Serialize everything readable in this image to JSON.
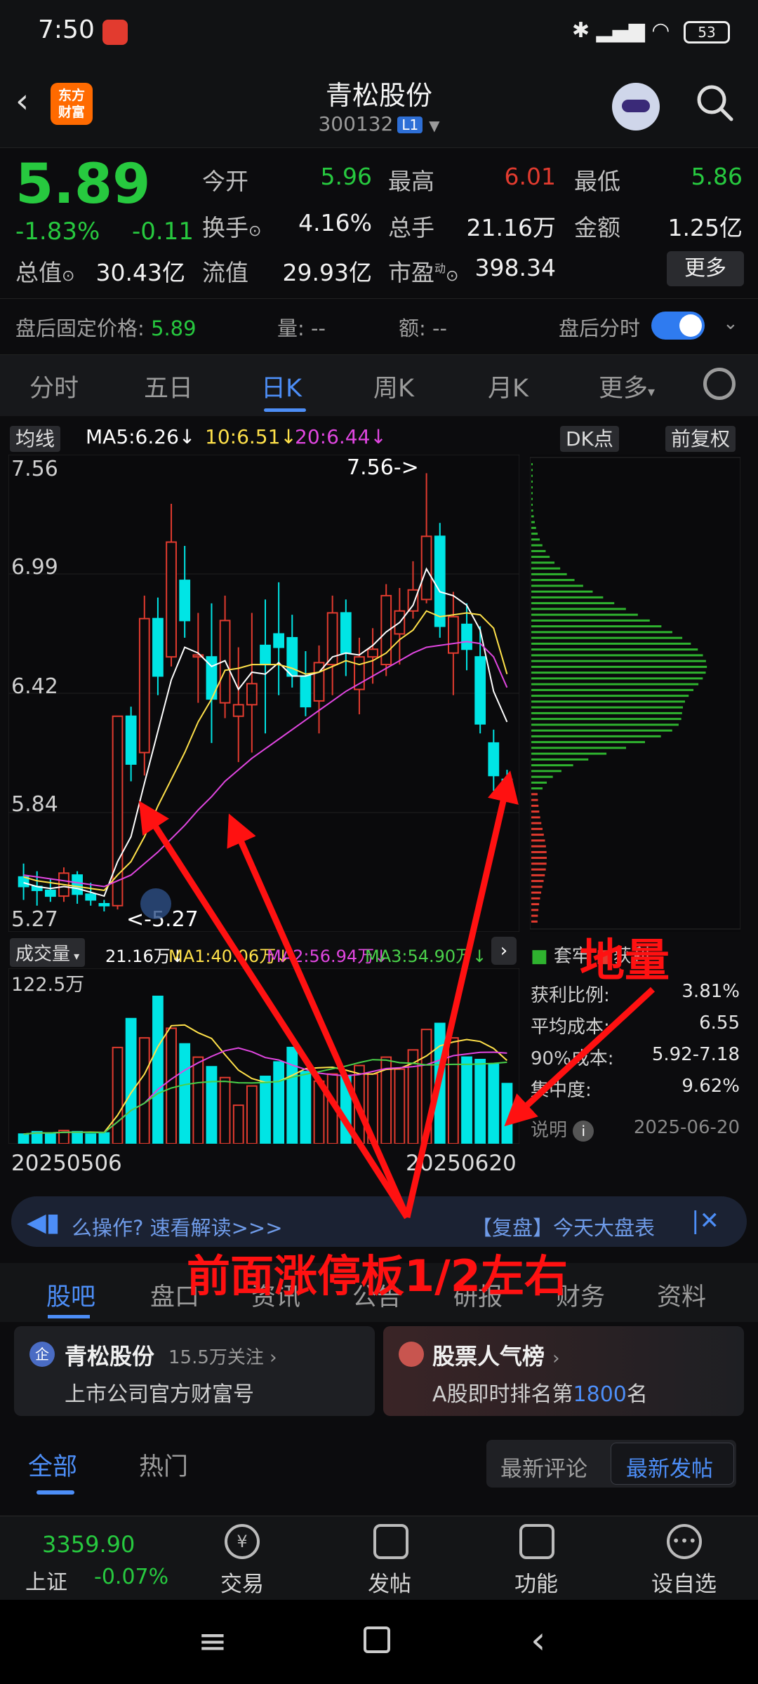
{
  "status_bar": {
    "time": "7:50",
    "battery": "53"
  },
  "header": {
    "title": "青松股份",
    "code": "300132",
    "level": "L1",
    "logo_text_1": "东方",
    "logo_text_2": "财富"
  },
  "quote": {
    "price": "5.89",
    "change_pct": "-1.83%",
    "change": "-0.11",
    "open_label": "今开",
    "open": "5.96",
    "high_label": "最高",
    "high": "6.01",
    "low_label": "最低",
    "low": "5.86",
    "turnover_label": "换手",
    "turnover": "4.16%",
    "volume_label": "总手",
    "volume": "21.16万",
    "amount_label": "金额",
    "amount": "1.25亿",
    "mcap_label": "总值",
    "mcap": "30.43亿",
    "float_label": "流值",
    "float": "29.93亿",
    "pe_label": "市盈",
    "pe_sup": "动",
    "pe": "398.34",
    "more": "更多"
  },
  "after_hours": {
    "price_label": "盘后固定价格:",
    "price": "5.89",
    "vol": "量: --",
    "amt": "额: --",
    "toggle_label": "盘后分时",
    "toggle_on": true
  },
  "tabs": [
    "分时",
    "五日",
    "日K",
    "周K",
    "月K",
    "更多"
  ],
  "active_tab": "日K",
  "indicators": {
    "ma_type": "均线",
    "ma5": "MA5:6.26↓",
    "ma10": "10:6.51↓",
    "ma20": "20:6.44↓",
    "dk": "DK点",
    "adjust": "前复权",
    "colors": {
      "ma5": "#ffffff",
      "ma10": "#ffe14a",
      "ma20": "#e046e0"
    }
  },
  "chart_data": {
    "type": "candlestick",
    "price_ticks": [
      "7.56",
      "6.99",
      "6.42",
      "5.84",
      "5.27"
    ],
    "ylim": [
      5.2,
      7.62
    ],
    "max_label": "7.56->",
    "min_label": "<-5.27",
    "x_start": "20250506",
    "x_end": "20250620",
    "candles": [
      {
        "o": 5.45,
        "h": 5.52,
        "l": 5.33,
        "c": 5.4
      },
      {
        "o": 5.4,
        "h": 5.48,
        "l": 5.3,
        "c": 5.38
      },
      {
        "o": 5.38,
        "h": 5.44,
        "l": 5.32,
        "c": 5.35
      },
      {
        "o": 5.35,
        "h": 5.5,
        "l": 5.32,
        "c": 5.47
      },
      {
        "o": 5.46,
        "h": 5.48,
        "l": 5.31,
        "c": 5.36
      },
      {
        "o": 5.36,
        "h": 5.42,
        "l": 5.3,
        "c": 5.33
      },
      {
        "o": 5.31,
        "h": 5.33,
        "l": 5.27,
        "c": 5.3
      },
      {
        "o": 5.3,
        "h": 6.29,
        "l": 5.28,
        "c": 6.29
      },
      {
        "o": 6.29,
        "h": 6.34,
        "l": 5.95,
        "c": 6.04
      },
      {
        "o": 6.1,
        "h": 6.92,
        "l": 5.98,
        "c": 6.8
      },
      {
        "o": 6.8,
        "h": 6.91,
        "l": 6.4,
        "c": 6.5
      },
      {
        "o": 6.6,
        "h": 7.4,
        "l": 6.55,
        "c": 7.2
      },
      {
        "o": 7.0,
        "h": 7.18,
        "l": 6.7,
        "c": 6.79
      },
      {
        "o": 6.6,
        "h": 6.83,
        "l": 6.36,
        "c": 6.61
      },
      {
        "o": 6.6,
        "h": 6.88,
        "l": 6.15,
        "c": 6.38
      },
      {
        "o": 6.36,
        "h": 6.92,
        "l": 6.28,
        "c": 6.79
      },
      {
        "o": 6.29,
        "h": 6.65,
        "l": 6.05,
        "c": 6.35
      },
      {
        "o": 6.35,
        "h": 6.83,
        "l": 6.1,
        "c": 6.46
      },
      {
        "o": 6.66,
        "h": 6.9,
        "l": 6.2,
        "c": 6.56
      },
      {
        "o": 6.72,
        "h": 6.99,
        "l": 6.4,
        "c": 6.65
      },
      {
        "o": 6.7,
        "h": 6.82,
        "l": 6.44,
        "c": 6.5
      },
      {
        "o": 6.5,
        "h": 6.63,
        "l": 6.29,
        "c": 6.34
      },
      {
        "o": 6.37,
        "h": 6.66,
        "l": 6.2,
        "c": 6.57
      },
      {
        "o": 6.56,
        "h": 6.92,
        "l": 6.4,
        "c": 6.83
      },
      {
        "o": 6.83,
        "h": 6.9,
        "l": 6.5,
        "c": 6.62
      },
      {
        "o": 6.43,
        "h": 6.7,
        "l": 6.3,
        "c": 6.6
      },
      {
        "o": 6.6,
        "h": 6.75,
        "l": 6.46,
        "c": 6.64
      },
      {
        "o": 6.56,
        "h": 6.98,
        "l": 6.5,
        "c": 6.92
      },
      {
        "o": 6.72,
        "h": 6.96,
        "l": 6.56,
        "c": 6.84
      },
      {
        "o": 6.84,
        "h": 7.1,
        "l": 6.8,
        "c": 6.95
      },
      {
        "o": 6.9,
        "h": 7.56,
        "l": 6.88,
        "c": 7.23
      },
      {
        "o": 7.23,
        "h": 7.3,
        "l": 6.7,
        "c": 6.76
      },
      {
        "o": 6.62,
        "h": 6.94,
        "l": 6.4,
        "c": 6.81
      },
      {
        "o": 6.77,
        "h": 6.88,
        "l": 6.53,
        "c": 6.64
      },
      {
        "o": 6.6,
        "h": 6.76,
        "l": 6.2,
        "c": 6.25
      },
      {
        "o": 6.15,
        "h": 6.22,
        "l": 5.9,
        "c": 5.98
      },
      {
        "o": 5.96,
        "h": 6.01,
        "l": 5.86,
        "c": 5.89
      }
    ],
    "ma5": [
      5.42,
      5.4,
      5.39,
      5.4,
      5.39,
      5.37,
      5.35,
      5.53,
      5.66,
      5.94,
      6.21,
      6.48,
      6.65,
      6.62,
      6.55,
      6.58,
      6.43,
      6.52,
      6.51,
      6.57,
      6.5,
      6.5,
      6.52,
      6.6,
      6.62,
      6.61,
      6.66,
      6.73,
      6.78,
      6.87,
      7.06,
      6.94,
      6.92,
      6.87,
      6.74,
      6.42,
      6.26
    ],
    "ma10": [
      5.45,
      5.43,
      5.42,
      5.41,
      5.4,
      5.39,
      5.38,
      5.46,
      5.53,
      5.66,
      5.82,
      5.96,
      6.1,
      6.26,
      6.38,
      6.53,
      6.54,
      6.56,
      6.56,
      6.56,
      6.54,
      6.51,
      6.52,
      6.55,
      6.58,
      6.56,
      6.58,
      6.62,
      6.69,
      6.74,
      6.84,
      6.81,
      6.82,
      6.83,
      6.82,
      6.75,
      6.51
    ],
    "ma20": [
      5.46,
      5.45,
      5.44,
      5.43,
      5.42,
      5.41,
      5.4,
      5.43,
      5.46,
      5.52,
      5.58,
      5.65,
      5.72,
      5.8,
      5.87,
      5.95,
      6.01,
      6.07,
      6.12,
      6.17,
      6.22,
      6.27,
      6.32,
      6.37,
      6.42,
      6.46,
      6.5,
      6.54,
      6.58,
      6.62,
      6.65,
      6.66,
      6.67,
      6.68,
      6.67,
      6.6,
      6.44
    ],
    "volume": {
      "label": "成交量",
      "ticks": [
        "122.5万"
      ],
      "ymax": 122.5,
      "vol_text": "21.16万↓",
      "ma1": "MA1:40.06万↓",
      "ma2": "MA2:56.94万↓",
      "ma3": "MA3:54.90万↓",
      "colors": {
        "ma1": "#ffe14a",
        "ma2": "#e046e0",
        "ma3": "#4ad14a"
      },
      "values": [
        8,
        10,
        9,
        11,
        10,
        8,
        9,
        80,
        104,
        88,
        122.5,
        96,
        83,
        72,
        64,
        55,
        32,
        48,
        56,
        68,
        80,
        60,
        52,
        58,
        56,
        65,
        58,
        72,
        62,
        78,
        95,
        100,
        88,
        72,
        70,
        66,
        50
      ]
    }
  },
  "chips": {
    "legend_trapped": "套牢",
    "legend_profit": "获利",
    "profit_ratio_label": "获利比例:",
    "profit_ratio": "3.81%",
    "avg_cost_label": "平均成本:",
    "avg_cost": "6.55",
    "cost90_label": "90%成本:",
    "cost90": "5.92-7.18",
    "concentration_label": "集中度:",
    "concentration": "9.62%",
    "note_label": "说明",
    "date": "2025-06-20",
    "profit_color": "#2fb32f",
    "trapped_color": "#e23b2f"
  },
  "banner": {
    "left_text": "么操作? 速看解读>>>",
    "right_text": "【复盘】今天大盘表"
  },
  "sub_tabs": [
    "股吧",
    "盘口",
    "资讯",
    "公告",
    "研报",
    "财务",
    "资料"
  ],
  "cards": {
    "card1_title": "青松股份",
    "card1_follow": "15.5万关注",
    "card1_sub": "上市公司官方财富号",
    "card2_title": "股票人气榜",
    "card2_sub_pre": "A股即时排名第",
    "card2_rank": "1800",
    "card2_sub_post": "名"
  },
  "feed_filter": {
    "all": "全部",
    "hot": "热门",
    "latest_comment": "最新评论",
    "latest_post": "最新发帖"
  },
  "bottom_bar": {
    "index_value": "3359.90",
    "index_name": "上证",
    "index_change": "-0.07%",
    "trade": "交易",
    "post": "发帖",
    "function": "功能",
    "watch": "设自选"
  },
  "annotations": {
    "volume_note": "地量",
    "price_note": "前面涨停板1/2左右"
  }
}
